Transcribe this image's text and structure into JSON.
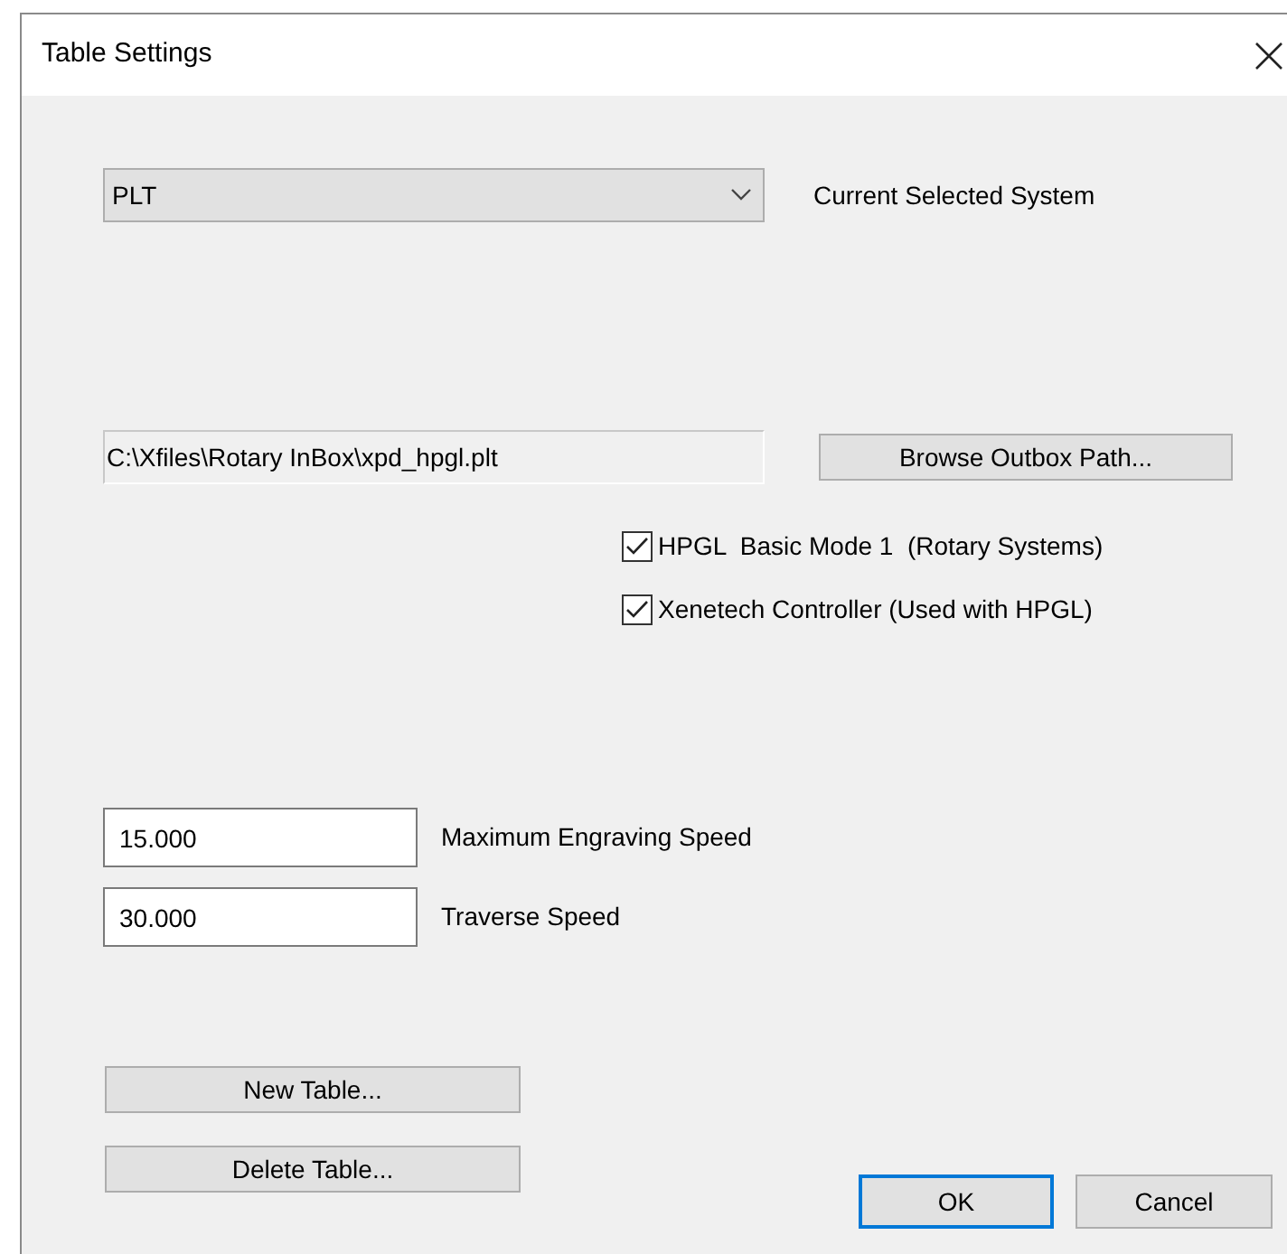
{
  "window": {
    "title": "Table Settings"
  },
  "system": {
    "value": "PLT",
    "label": "Current Selected System"
  },
  "outbox": {
    "value": "C:\\Xfiles\\Rotary InBox\\xpd_hpgl.plt",
    "button": "Browse Outbox Path..."
  },
  "options": [
    {
      "label": "HPGL  Basic Mode 1  (Rotary Systems)",
      "checked": true
    },
    {
      "label": "Xenetech Controller (Used with HPGL)",
      "checked": true
    }
  ],
  "speeds": [
    {
      "value": "15.000",
      "label": "Maximum Engraving Speed"
    },
    {
      "value": "30.000",
      "label": "Traverse Speed"
    }
  ],
  "table_buttons": [
    "New Table...",
    "Delete Table..."
  ],
  "dialog_buttons": [
    {
      "label": "OK",
      "default": true
    },
    {
      "label": "Cancel",
      "default": false
    }
  ]
}
